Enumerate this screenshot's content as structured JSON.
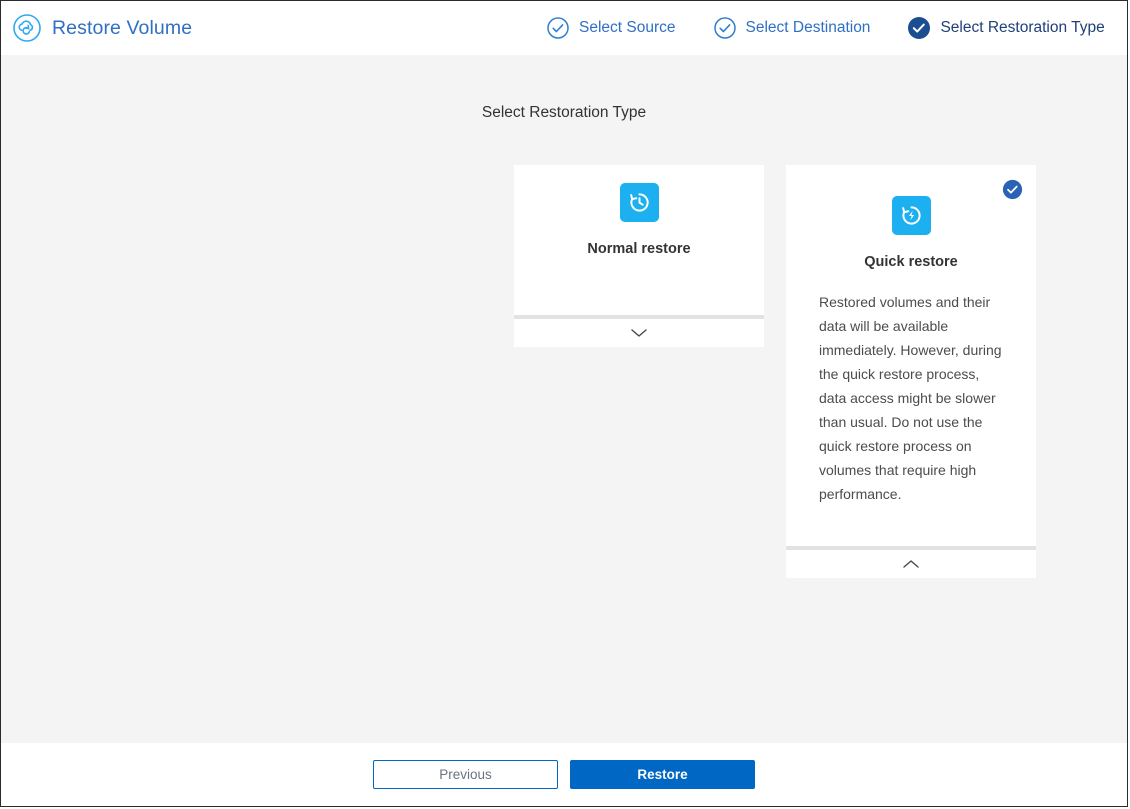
{
  "header": {
    "logo_icon": "cloud-restore-icon",
    "title": "Restore Volume",
    "steps": [
      {
        "label": "Select Source",
        "icon": "check-circle-outline-icon",
        "state": "completed"
      },
      {
        "label": "Select Destination",
        "icon": "check-circle-outline-icon",
        "state": "completed"
      },
      {
        "label": "Select Restoration Type",
        "icon": "check-circle-filled-icon",
        "state": "current"
      }
    ]
  },
  "main": {
    "page_title": "Select Restoration Type",
    "cards": [
      {
        "id": "normal-restore",
        "icon": "clock-history-icon",
        "label": "Normal restore",
        "description": "",
        "expanded": false,
        "selected": false,
        "toggle_icon": "chevron-down-icon"
      },
      {
        "id": "quick-restore",
        "icon": "lightning-refresh-icon",
        "label": "Quick restore",
        "description": "Restored volumes and their data will be available immediately. However, during the quick restore process, data access might be slower than usual. Do not use the quick restore process on volumes that require high performance.",
        "expanded": true,
        "selected": true,
        "selected_badge_icon": "check-circle-filled-icon",
        "toggle_icon": "chevron-up-icon"
      }
    ]
  },
  "footer": {
    "previous_label": "Previous",
    "restore_label": "Restore"
  },
  "colors": {
    "accent_blue": "#0067c5",
    "link_blue": "#2f6fc4",
    "icon_blue": "#1cb0f0",
    "badge_blue": "#2a63b5",
    "page_bg": "#f4f4f4"
  }
}
